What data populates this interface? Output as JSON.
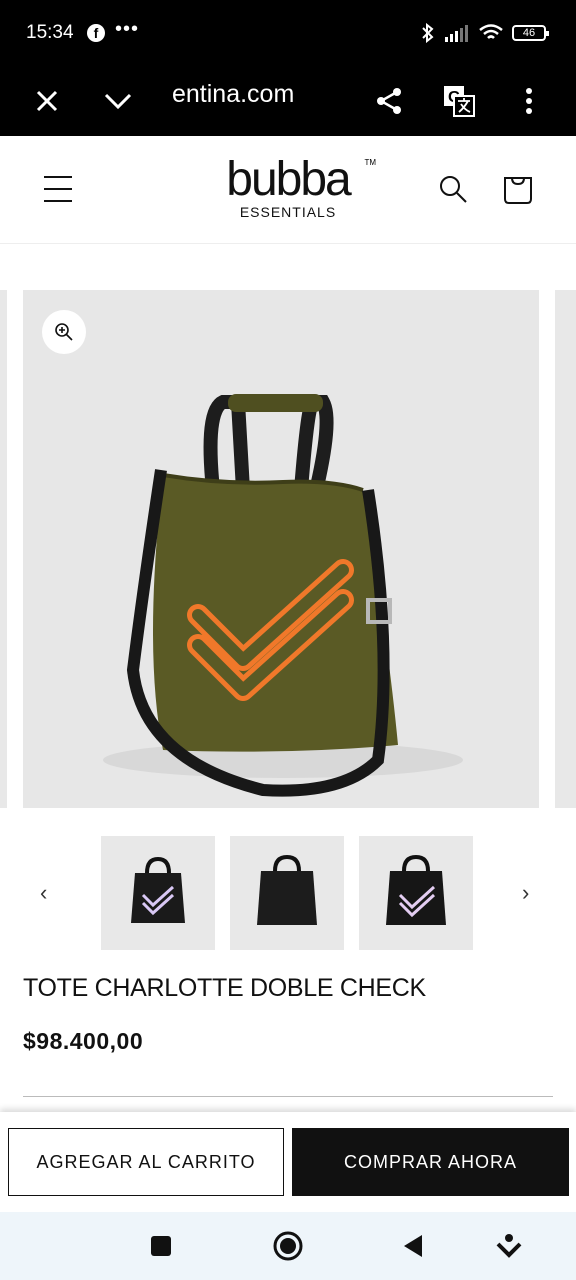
{
  "status_bar": {
    "time": "15:34",
    "more": "•••",
    "battery": "46"
  },
  "browser": {
    "url": "entina.com"
  },
  "header": {
    "brand": "bubba",
    "brand_tm": "TM",
    "brand_sub": "ESSENTIALS"
  },
  "gallery": {
    "thumbnails": [
      {
        "variant": "black-check-purple"
      },
      {
        "variant": "black-plain"
      },
      {
        "variant": "black-check-lilac"
      }
    ],
    "prev_arrow": "‹",
    "next_arrow": "›"
  },
  "product": {
    "title": "TOTE CHARLOTTE DOBLE CHECK",
    "price": "$98.400,00"
  },
  "actions": {
    "add_to_cart": "AGREGAR AL CARRITO",
    "buy_now": "COMPRAR AHORA"
  },
  "colors": {
    "bag_green": "#5a5a25",
    "check_orange": "#f0782a",
    "accent_black": "#111111"
  }
}
